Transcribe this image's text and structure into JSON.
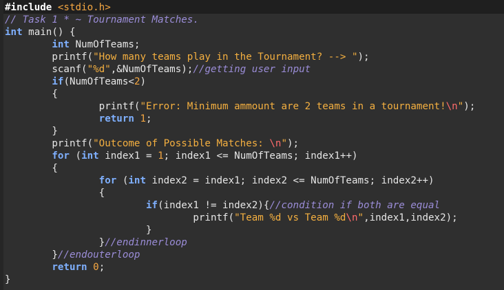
{
  "editor": {
    "lines": [
      [
        {
          "c": "pp",
          "t": "#include "
        },
        {
          "c": "hdr",
          "t": "<stdio.h>"
        }
      ],
      [
        {
          "c": "cmt",
          "t": "// Task 1 * ~ Tournament Matches."
        }
      ],
      [
        {
          "c": "ty",
          "t": "int"
        },
        {
          "c": "fn",
          "t": " main() {"
        }
      ],
      [
        {
          "c": "fn",
          "t": "        "
        },
        {
          "c": "ty",
          "t": "int"
        },
        {
          "c": "fn",
          "t": " NumOfTeams;"
        }
      ],
      [
        {
          "c": "fn",
          "t": "        printf("
        },
        {
          "c": "str",
          "t": "\"How many teams play in the Tournament? --> \""
        },
        {
          "c": "fn",
          "t": ");"
        }
      ],
      [
        {
          "c": "fn",
          "t": "        scanf("
        },
        {
          "c": "str",
          "t": "\"%d\""
        },
        {
          "c": "fn",
          "t": ",&NumOfTeams);"
        },
        {
          "c": "cmt",
          "t": "//getting user input"
        }
      ],
      [
        {
          "c": "fn",
          "t": "        "
        },
        {
          "c": "kw",
          "t": "if"
        },
        {
          "c": "fn",
          "t": "(NumOfTeams<"
        },
        {
          "c": "num",
          "t": "2"
        },
        {
          "c": "fn",
          "t": ")"
        }
      ],
      [
        {
          "c": "fn",
          "t": "        {"
        }
      ],
      [
        {
          "c": "fn",
          "t": "                printf("
        },
        {
          "c": "str",
          "t": "\"Error: Minimum ammount are 2 teams in a tournament!"
        },
        {
          "c": "esc",
          "t": "\\n"
        },
        {
          "c": "str",
          "t": "\""
        },
        {
          "c": "fn",
          "t": ");"
        }
      ],
      [
        {
          "c": "fn",
          "t": "                "
        },
        {
          "c": "kw",
          "t": "return"
        },
        {
          "c": "fn",
          "t": " "
        },
        {
          "c": "num",
          "t": "1"
        },
        {
          "c": "fn",
          "t": ";"
        }
      ],
      [
        {
          "c": "fn",
          "t": "        }"
        }
      ],
      [
        {
          "c": "fn",
          "t": "        printf("
        },
        {
          "c": "str",
          "t": "\"Outcome of Possible Matches: "
        },
        {
          "c": "esc",
          "t": "\\n"
        },
        {
          "c": "str",
          "t": "\""
        },
        {
          "c": "fn",
          "t": ");"
        }
      ],
      [
        {
          "c": "fn",
          "t": "        "
        },
        {
          "c": "kw",
          "t": "for"
        },
        {
          "c": "fn",
          "t": " ("
        },
        {
          "c": "ty",
          "t": "int"
        },
        {
          "c": "fn",
          "t": " index1 = "
        },
        {
          "c": "num",
          "t": "1"
        },
        {
          "c": "fn",
          "t": "; index1 <= NumOfTeams; index1++)"
        }
      ],
      [
        {
          "c": "fn",
          "t": "        {"
        }
      ],
      [
        {
          "c": "fn",
          "t": "                "
        },
        {
          "c": "kw",
          "t": "for"
        },
        {
          "c": "fn",
          "t": " ("
        },
        {
          "c": "ty",
          "t": "int"
        },
        {
          "c": "fn",
          "t": " index2 = index1; index2 <= NumOfTeams; index2++)"
        }
      ],
      [
        {
          "c": "fn",
          "t": "                {"
        }
      ],
      [
        {
          "c": "fn",
          "t": "                        "
        },
        {
          "c": "kw",
          "t": "if"
        },
        {
          "c": "fn",
          "t": "(index1 != index2){"
        },
        {
          "c": "cmt",
          "t": "//condition if both are equal"
        }
      ],
      [
        {
          "c": "fn",
          "t": "                                printf("
        },
        {
          "c": "str",
          "t": "\"Team %d vs Team %d"
        },
        {
          "c": "esc",
          "t": "\\n"
        },
        {
          "c": "str",
          "t": "\""
        },
        {
          "c": "fn",
          "t": ",index1,index2);"
        }
      ],
      [
        {
          "c": "fn",
          "t": "                        }"
        }
      ],
      [
        {
          "c": "fn",
          "t": "                }"
        },
        {
          "c": "cmt",
          "t": "//endinnerloop"
        }
      ],
      [
        {
          "c": "fn",
          "t": "        }"
        },
        {
          "c": "cmt",
          "t": "//endouterloop"
        }
      ],
      [
        {
          "c": "fn",
          "t": "        "
        },
        {
          "c": "kw",
          "t": "return"
        },
        {
          "c": "fn",
          "t": " "
        },
        {
          "c": "num",
          "t": "0"
        },
        {
          "c": "fn",
          "t": ";"
        }
      ],
      [
        {
          "c": "fn",
          "t": "}"
        }
      ]
    ]
  }
}
